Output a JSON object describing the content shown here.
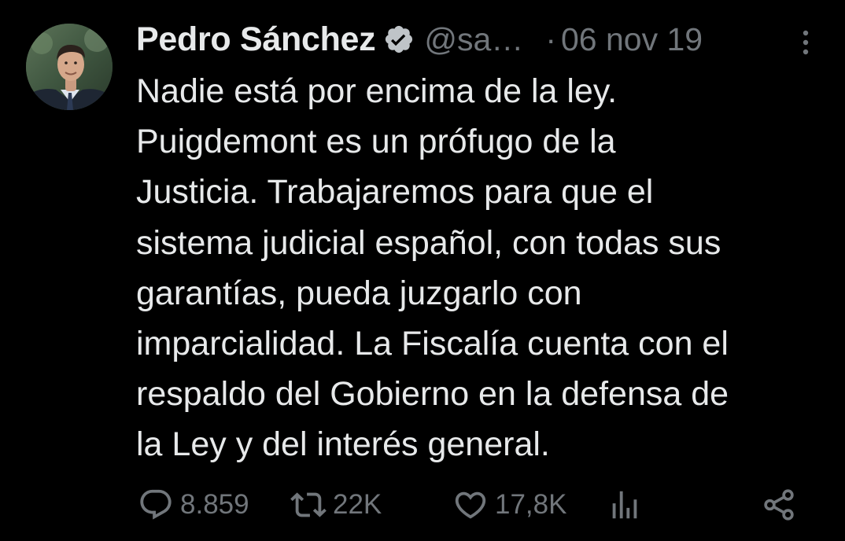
{
  "tweet": {
    "author": {
      "display_name": "Pedro Sánchez",
      "handle": "@sa…",
      "verified": true,
      "avatar_icon": "avatar-photo"
    },
    "separator": "·",
    "date": "06 nov 19",
    "text_lines": [
      "Nadie está por encima de la ley.",
      "Puigdemont es un prófugo de la",
      "Justicia. Trabajaremos para que el",
      "sistema judicial español, con todas sus",
      "garantías, pueda juzgarlo con",
      "imparcialidad. La Fiscalía cuenta con el",
      "respaldo del Gobierno en la defensa de",
      "la Ley y del interés general."
    ],
    "stats": {
      "replies": "8.859",
      "retweets": "22K",
      "likes": "17,8K"
    }
  },
  "icons": {
    "more": "more-vertical-icon",
    "reply": "reply-icon",
    "retweet": "retweet-icon",
    "like": "heart-icon",
    "views": "views-bar-chart-icon",
    "share": "share-icon",
    "verified": "verified-badge-icon"
  },
  "colors": {
    "background": "#000000",
    "primary_text": "#e7e9ea",
    "secondary_text": "#71767b"
  }
}
